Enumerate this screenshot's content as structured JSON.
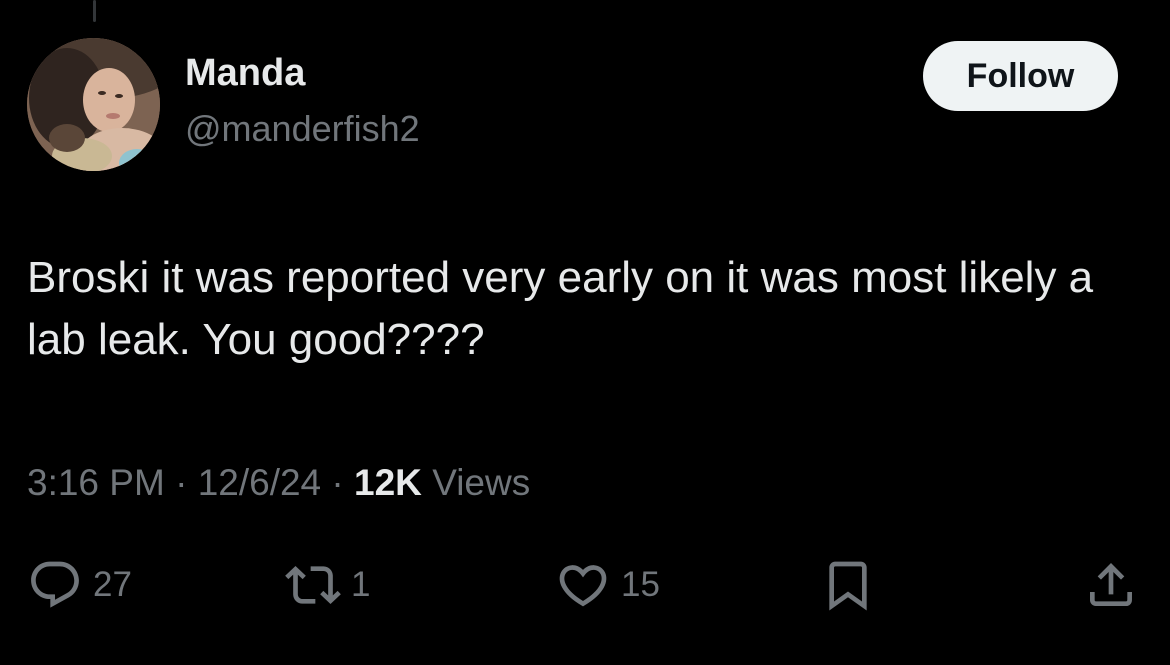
{
  "author": {
    "display_name": "Manda",
    "handle": "@manderfish2"
  },
  "follow_button": {
    "label": "Follow"
  },
  "tweet": {
    "text": "Broski it was reported very early on it was most likely a lab leak. You good????"
  },
  "meta": {
    "time": "3:16 PM",
    "separator": "·",
    "date": "12/6/24",
    "views_count": "12K",
    "views_label": "Views"
  },
  "actions": {
    "replies": "27",
    "reposts": "1",
    "likes": "15"
  },
  "icons": {
    "reply": "reply-icon",
    "repost": "repost-icon",
    "like": "heart-icon",
    "bookmark": "bookmark-icon",
    "share": "share-icon"
  },
  "colors": {
    "background": "#000000",
    "primary_text": "#e7e9ea",
    "secondary_text": "#71767b",
    "follow_button_bg": "#eff3f4",
    "follow_button_text": "#0f1419"
  }
}
